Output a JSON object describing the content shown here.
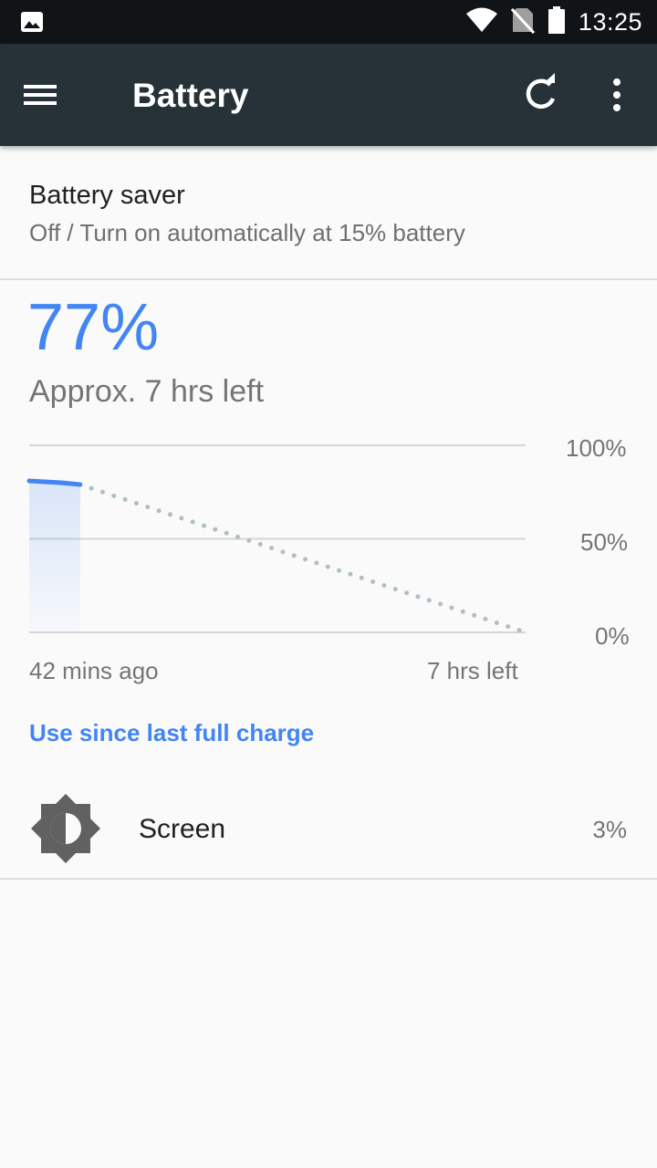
{
  "status_bar": {
    "time": "13:25",
    "icons": [
      "image-notification-icon",
      "wifi-icon",
      "no-sim-icon",
      "battery-icon"
    ]
  },
  "app_bar": {
    "title": "Battery",
    "icons": [
      "menu-icon",
      "refresh-icon",
      "more-vert-icon"
    ]
  },
  "battery_saver": {
    "title": "Battery saver",
    "summary": "Off / Turn on automatically at 15% battery"
  },
  "battery": {
    "percent": "77%",
    "estimate": "Approx. 7 hrs left"
  },
  "chart_data": {
    "type": "line",
    "y_ticks": [
      "100%",
      "50%",
      "0%"
    ],
    "x_labels": [
      "42 mins ago",
      "7 hrs left"
    ],
    "ylim": [
      0,
      100
    ],
    "series": [
      {
        "values": [
          [
            0,
            81
          ],
          [
            0.5,
            80
          ],
          [
            0.8,
            79
          ]
        ]
      },
      {
        "values": [
          [
            0.8,
            79
          ],
          [
            7.8,
            0
          ]
        ]
      }
    ],
    "colors": {
      "history": "#4285f4",
      "projection": "#b0bec5",
      "grid": "#d6d6d6"
    }
  },
  "usage": {
    "link_label": "Use since last full charge",
    "items": [
      {
        "name": "Screen",
        "percent": "3%",
        "icon": "brightness-icon"
      }
    ]
  },
  "colors": {
    "accent": "#4285f4",
    "app_bar": "#263238",
    "status_bar": "#111417",
    "background": "#fafafa"
  }
}
